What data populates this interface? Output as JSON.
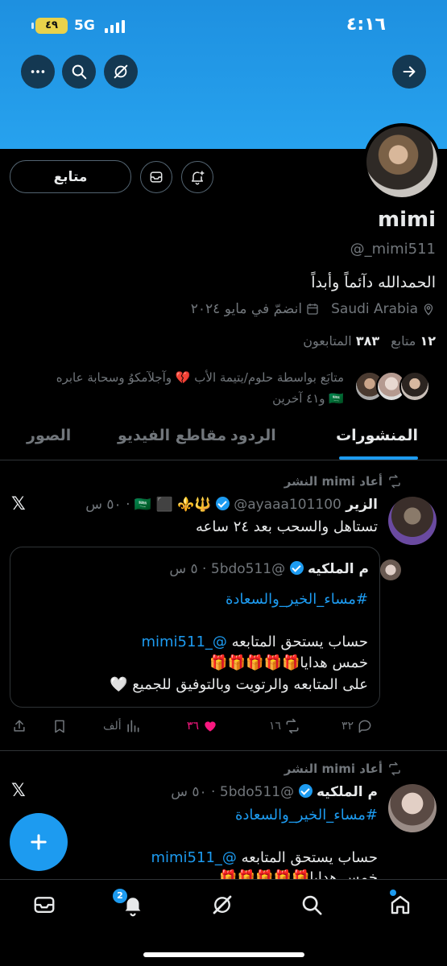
{
  "status_bar": {
    "time": "٤:١٦",
    "network": "5G",
    "battery": "٤٩"
  },
  "profile": {
    "follow_button": "متابع",
    "name": "mimi",
    "handle": "@_mimi511",
    "bio": "الحمدالله دآئماً وأبداً",
    "location": "Saudi Arabia",
    "joined": "انضمّ في مايو ٢٠٢٤",
    "following_count": "١٢",
    "following_label": "متابع",
    "followers_count": "٣٨٣",
    "followers_label": "المتابعون",
    "followed_by_line1": "متابَع بواسطة حلوم/يتيمة الأب 💔 وآجلآمكوُ وسحابة عابره",
    "followed_by_line2": "🇸🇦 و٤١ آخرين"
  },
  "tabs": [
    {
      "label": "المنشورات",
      "active": true
    },
    {
      "label": "الردود",
      "active": false
    },
    {
      "label": "مقاطع الفيديو",
      "active": false
    },
    {
      "label": "الصور",
      "active": false
    }
  ],
  "posts": [
    {
      "repost_label": "أعاد mimi النشر",
      "author_name": "الزير",
      "author_emoji": "🇸🇦 ⬛ ⚜️🔱",
      "author_handle": "@ayaaa101100",
      "time": "٥٠ س",
      "text": "تستاهل والسحب بعد ٢٤ ساعه",
      "quote": {
        "author_name": "م الملكيه",
        "author_handle": "@5bdo511",
        "time": "٥ س",
        "hashtag": "#مساء_الخير_والسعادة",
        "line1": "حساب يستحق المتابعه",
        "mention": "@_mimi511",
        "line2": "خمس هدايا🎁🎁🎁🎁🎁",
        "line3": "على المتابعه والرتويت وبالتوفيق للجميع 🤍"
      },
      "actions": {
        "replies": "٣٢",
        "reposts": "١٦",
        "likes": "٣٦",
        "views": "ألف"
      }
    },
    {
      "repost_label": "أعاد mimi النشر",
      "author_name": "م الملكيه",
      "author_handle": "@5bdo511",
      "time": "٥٠ س",
      "hashtag": "#مساء_الخير_والسعادة",
      "line1": "حساب يستحق المتابعه",
      "mention": "@_mimi511",
      "line2": "خمس هدايا🎁🎁🎁🎁🎁"
    }
  ],
  "nav": {
    "notifications_badge": "2"
  },
  "icons": [
    "back-arrow-icon",
    "grok-icon",
    "search-icon",
    "more-icon",
    "notify-plus-icon",
    "message-icon",
    "location-icon",
    "calendar-icon",
    "repost-icon",
    "reply-icon",
    "like-icon",
    "views-icon",
    "bookmark-icon",
    "share-icon",
    "x-logo-icon",
    "home-icon",
    "notifications-icon",
    "messages-icon",
    "plus-icon",
    "verified-icon"
  ],
  "colors": {
    "banner": "#1e90e0",
    "accent": "#1d9bf0",
    "like": "#f91880",
    "background": "#000000"
  }
}
